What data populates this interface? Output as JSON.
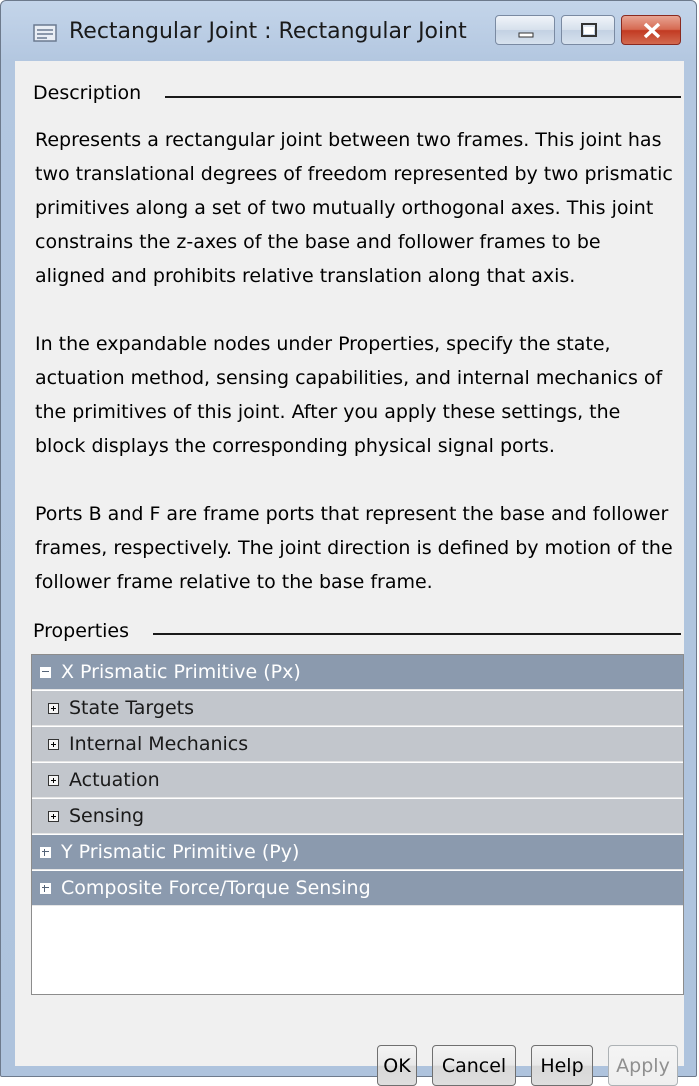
{
  "window": {
    "title": "Rectangular Joint : Rectangular Joint"
  },
  "description": {
    "label": "Description",
    "paragraphs": [
      "Represents a rectangular joint between two frames. This joint has two translational degrees of freedom represented by two prismatic primitives along a set of two mutually orthogonal axes. This joint constrains the z-axes of the base and follower frames to be aligned and prohibits relative translation along that axis.",
      "In the expandable nodes under Properties, specify the state, actuation method, sensing capabilities, and internal mechanics of the primitives of this joint. After you apply these settings, the block displays the corresponding physical signal ports.",
      "Ports B and F are frame ports that represent the base and follower frames, respectively. The joint direction is defined by motion of the follower frame relative to the base frame."
    ]
  },
  "properties": {
    "label": "Properties",
    "nodes": [
      {
        "label": "X Prismatic Primitive (Px)",
        "expanded": true
      },
      {
        "label": "State Targets",
        "expanded": false
      },
      {
        "label": "Internal Mechanics",
        "expanded": false
      },
      {
        "label": "Actuation",
        "expanded": false
      },
      {
        "label": "Sensing",
        "expanded": false
      },
      {
        "label": "Y Prismatic Primitive (Py)",
        "expanded": false
      },
      {
        "label": "Composite Force/Torque Sensing",
        "expanded": false
      }
    ]
  },
  "buttons": {
    "ok": "OK",
    "cancel": "Cancel",
    "help": "Help",
    "apply": "Apply"
  },
  "colors": {
    "top_node_bg": "#8b9aae",
    "sub_node_bg": "#c2c6cc",
    "close_button": "#c23a22"
  }
}
